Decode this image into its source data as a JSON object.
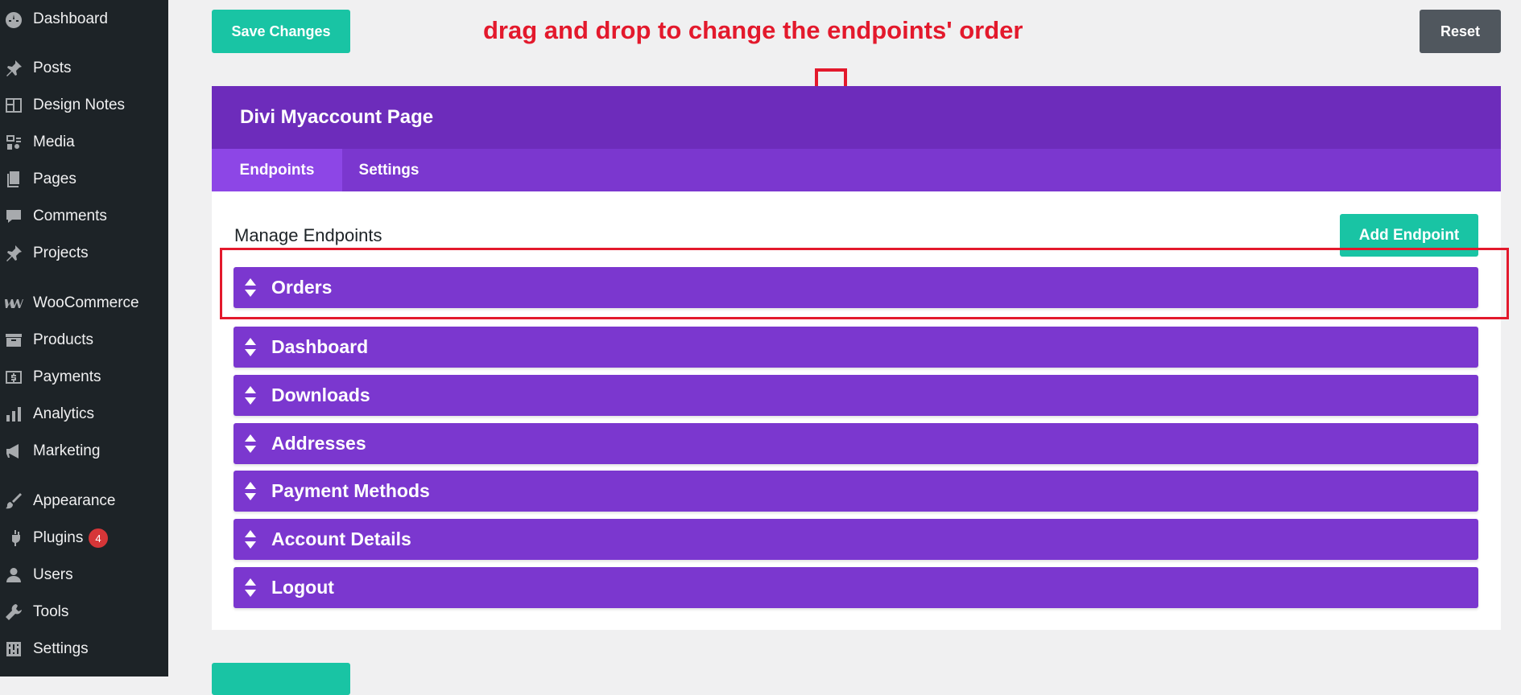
{
  "sidebar": {
    "items": [
      {
        "label": "Dashboard",
        "icon": "dashboard-icon"
      },
      {
        "label": "Posts",
        "icon": "pin-icon"
      },
      {
        "label": "Design Notes",
        "icon": "layout-icon"
      },
      {
        "label": "Media",
        "icon": "media-icon"
      },
      {
        "label": "Pages",
        "icon": "pages-icon"
      },
      {
        "label": "Comments",
        "icon": "comment-icon"
      },
      {
        "label": "Projects",
        "icon": "pin-icon"
      },
      {
        "label": "WooCommerce",
        "icon": "woo-icon"
      },
      {
        "label": "Products",
        "icon": "archive-icon"
      },
      {
        "label": "Payments",
        "icon": "dollar-icon"
      },
      {
        "label": "Analytics",
        "icon": "bar-chart-icon"
      },
      {
        "label": "Marketing",
        "icon": "megaphone-icon"
      },
      {
        "label": "Appearance",
        "icon": "brush-icon"
      },
      {
        "label": "Plugins",
        "icon": "plugin-icon",
        "badge": "4"
      },
      {
        "label": "Users",
        "icon": "user-icon"
      },
      {
        "label": "Tools",
        "icon": "wrench-icon"
      },
      {
        "label": "Settings",
        "icon": "settings-icon"
      }
    ]
  },
  "toolbar": {
    "save_label": "Save Changes",
    "reset_label": "Reset"
  },
  "annotation": {
    "text": "drag and drop to change the endpoints' order"
  },
  "panel": {
    "title": "Divi Myaccount Page",
    "tabs": [
      {
        "label": "Endpoints",
        "active": true
      },
      {
        "label": "Settings",
        "active": false
      }
    ],
    "section_title": "Manage Endpoints",
    "add_label": "Add Endpoint",
    "endpoints": [
      {
        "label": "Orders"
      },
      {
        "label": "Dashboard"
      },
      {
        "label": "Downloads"
      },
      {
        "label": "Addresses"
      },
      {
        "label": "Payment Methods"
      },
      {
        "label": "Account Details"
      },
      {
        "label": "Logout"
      }
    ]
  },
  "colors": {
    "accent": "#19c4a4",
    "purple_header": "#6d2cbb",
    "purple_item": "#7b37cf",
    "purple_active_tab": "#8d46e6",
    "annotation_red": "#e3192c",
    "sidebar_bg": "#1d2327"
  }
}
